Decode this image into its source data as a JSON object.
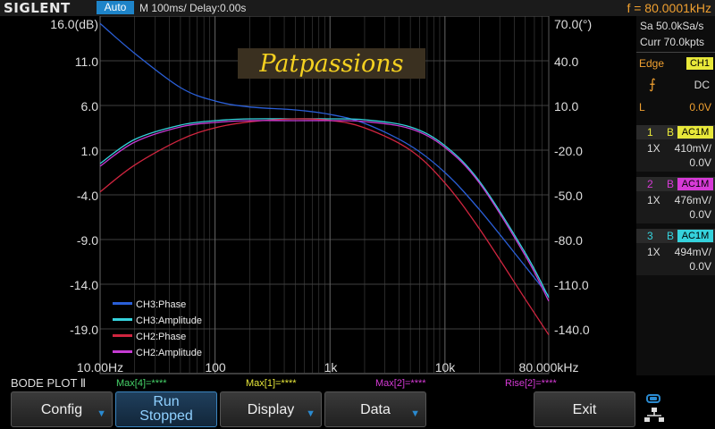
{
  "header": {
    "brand": "SIGLENT",
    "mode": "Auto",
    "timebase": "M 100ms/  Delay:0.00s",
    "frequency": "f = 80.0001kHz"
  },
  "plot": {
    "watermark": "Patpassions",
    "left_axis": [
      "16.0(dB)",
      "11.0",
      "6.0",
      "1.0",
      "-4.0",
      "-9.0",
      "-14.0",
      "-19.0"
    ],
    "right_axis": [
      "70.0(°)",
      "40.0",
      "10.0",
      "-20.0",
      "-50.0",
      "-80.0",
      "-110.0",
      "-140.0"
    ],
    "bottom_axis": [
      "10.00Hz",
      "100",
      "1k",
      "10k",
      "80.000kHz"
    ],
    "legend": [
      {
        "label": "CH3:Phase",
        "color": "#2a5fd8"
      },
      {
        "label": "CH3:Amplitude",
        "color": "#35d2dc"
      },
      {
        "label": "CH2:Phase",
        "color": "#d0253f"
      },
      {
        "label": "CH2:Amplitude",
        "color": "#c53bd3"
      }
    ]
  },
  "sidebar": {
    "sample_rate": "Sa 50.0kSa/s",
    "memory": "Curr 70.0kpts",
    "trigger_label": "Edge",
    "trigger_source": "CH1",
    "coupling": "DC",
    "level_label": "L",
    "level_value": "0.0V",
    "channels": [
      {
        "num": "1",
        "bw": "B",
        "coupling": "AC1M",
        "probe": "1X",
        "scale": "410mV/",
        "offset": "0.0V",
        "color": "#e8e83a"
      },
      {
        "num": "2",
        "bw": "B",
        "coupling": "AC1M",
        "probe": "1X",
        "scale": "476mV/",
        "offset": "0.0V",
        "color": "#d63ad6"
      },
      {
        "num": "3",
        "bw": "B",
        "coupling": "AC1M",
        "probe": "1X",
        "scale": "494mV/",
        "offset": "0.0V",
        "color": "#35d2dc"
      }
    ]
  },
  "status": {
    "title": "BODE PLOT Ⅱ",
    "m1": "Max[4]=****",
    "m2": "Max[1]=****",
    "m3": "Max[2]=****",
    "m4": "Rise[2]=****"
  },
  "menu": {
    "config": "Config",
    "run_line1": "Run",
    "run_line2": "Stopped",
    "display": "Display",
    "data": "Data",
    "exit": "Exit"
  },
  "icons": {
    "menu_arrow": "down-arrow-icon",
    "trigger": "rising-edge-icon",
    "usb": "usb-network-icon"
  },
  "chart_data": {
    "type": "line",
    "x_scale": "log",
    "xlim": [
      10,
      80000
    ],
    "ylim_left": [
      -24,
      16
    ],
    "ylim_right": [
      -170,
      70
    ],
    "series": [
      {
        "name": "CH3:Phase",
        "axis": "right",
        "color": "#2a5fd8",
        "x": [
          10,
          20,
          50,
          100,
          200,
          500,
          1000,
          2000,
          5000,
          10000,
          20000,
          50000,
          80000
        ],
        "y": [
          65,
          45,
          22,
          13,
          9,
          7,
          4,
          -2,
          -17,
          -35,
          -60,
          -98,
          -118
        ]
      },
      {
        "name": "CH3:Amplitude",
        "axis": "left",
        "color": "#35d2dc",
        "x": [
          10,
          20,
          50,
          100,
          200,
          500,
          1000,
          2000,
          5000,
          10000,
          20000,
          50000,
          80000
        ],
        "y": [
          -0.5,
          2.2,
          3.8,
          4.3,
          4.5,
          4.5,
          4.5,
          4.4,
          3.6,
          1.5,
          -2.5,
          -10.5,
          -15.5
        ]
      },
      {
        "name": "CH2:Phase",
        "axis": "right",
        "color": "#d0253f",
        "x": [
          10,
          20,
          50,
          100,
          200,
          500,
          1000,
          2000,
          5000,
          10000,
          20000,
          50000,
          80000
        ],
        "y": [
          -48,
          -30,
          -13,
          -5,
          -1,
          1,
          0,
          -5,
          -20,
          -42,
          -73,
          -120,
          -144
        ]
      },
      {
        "name": "CH2:Amplitude",
        "axis": "left",
        "color": "#c53bd3",
        "x": [
          10,
          20,
          50,
          100,
          200,
          500,
          1000,
          2000,
          5000,
          10000,
          20000,
          50000,
          80000
        ],
        "y": [
          -0.8,
          1.9,
          3.6,
          4.1,
          4.3,
          4.3,
          4.3,
          4.2,
          3.4,
          1.3,
          -2.7,
          -10.8,
          -15.9
        ]
      }
    ]
  }
}
